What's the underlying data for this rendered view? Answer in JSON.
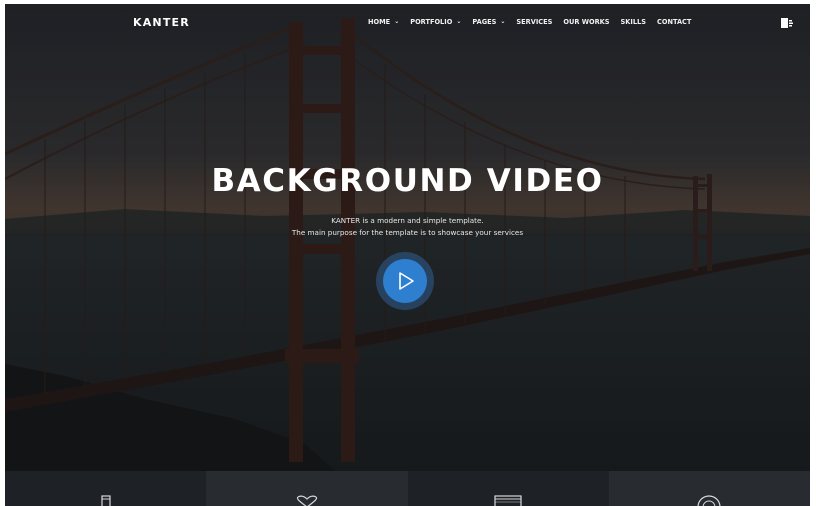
{
  "brand": {
    "logo_text": "KANTER"
  },
  "nav": {
    "items": [
      {
        "label": "HOME",
        "has_dropdown": true
      },
      {
        "label": "PORTFOLIO",
        "has_dropdown": true
      },
      {
        "label": "PAGES",
        "has_dropdown": true
      },
      {
        "label": "SERVICES",
        "has_dropdown": false
      },
      {
        "label": "OUR WORKS",
        "has_dropdown": false
      },
      {
        "label": "SKILLS",
        "has_dropdown": false
      },
      {
        "label": "CONTACT",
        "has_dropdown": false
      }
    ],
    "dropdown_caret": "⌄",
    "menu_icon": "sidebar-menu-icon"
  },
  "hero": {
    "title": "BACKGROUND VIDEO",
    "subtitle_line1": "KANTER is a modern and simple template.",
    "subtitle_line2": "The main purpose for the template is to showcase your services",
    "play_icon": "play-icon",
    "background": "golden-gate-bridge-dusk"
  },
  "features": {
    "icons": [
      "tablet-icon",
      "heart-icon",
      "browser-window-icon",
      "target-icon"
    ]
  },
  "colors": {
    "accent": "#2f7fd0",
    "overlay": "#1d2024",
    "text": "#ffffff"
  }
}
